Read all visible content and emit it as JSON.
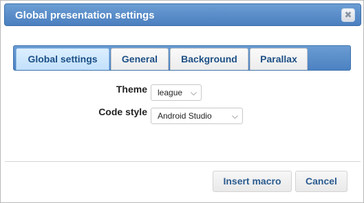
{
  "dialog": {
    "title": "Global presentation settings",
    "close_icon": "close-icon",
    "close_glyph": "✖"
  },
  "tabs": [
    {
      "label": "Global settings",
      "active": true
    },
    {
      "label": "General",
      "active": false
    },
    {
      "label": "Background",
      "active": false
    },
    {
      "label": "Parallax",
      "active": false
    }
  ],
  "form": {
    "theme_label": "Theme",
    "theme_value": "league",
    "code_style_label": "Code style",
    "code_style_value": "Android Studio",
    "caret_glyph": "⌵"
  },
  "footer": {
    "insert_label": "Insert macro",
    "cancel_label": "Cancel"
  }
}
